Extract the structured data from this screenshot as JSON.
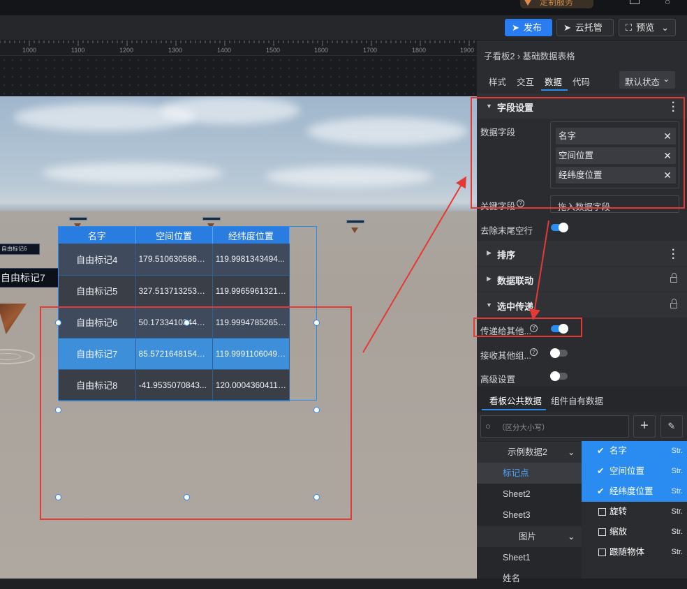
{
  "topbar": {
    "brand_text": "定制服务"
  },
  "toolbar": {
    "publish": "发布",
    "cloud": "云托管",
    "preview": "预览"
  },
  "ruler": {
    "ticks": [
      "1000",
      "1100",
      "1200",
      "1300",
      "1400",
      "1500",
      "1600",
      "1700",
      "1800",
      "1900"
    ]
  },
  "scene": {
    "label_mark6": "自由标记6",
    "label_mark7": "自由标记7"
  },
  "table": {
    "headers": [
      "名字",
      "空间位置",
      "经纬度位置"
    ],
    "rows": [
      [
        "自由标记4",
        "179.51063058621...",
        "119.9981343494..."
      ],
      [
        "自由标记5",
        "327.51371325368...",
        "119.99659613210..."
      ],
      [
        "自由标记6",
        "50.173341034473...",
        "119.99947852657..."
      ],
      [
        "自由标记7",
        "85.572164815412...",
        "119.99911060497..."
      ],
      [
        "自由标记8",
        "-41.9535070843...",
        "120.00043604119..."
      ]
    ]
  },
  "panel": {
    "breadcrumb_parent": "子看板2",
    "breadcrumb_current": "基础数据表格",
    "tabs": [
      "样式",
      "交互",
      "数据",
      "代码"
    ],
    "active_tab": "数据",
    "state_select": "默认状态",
    "field_section": "字段设置",
    "data_fields_label": "数据字段",
    "data_fields": [
      "名字",
      "空间位置",
      "经纬度位置"
    ],
    "key_field_label": "关键字段",
    "key_field_placeholder": "拖入数据字段",
    "trim_label": "去除末尾空行",
    "sort_section": "排序",
    "linkage_section": "数据联动",
    "select_pass_section": "选中传递",
    "pass_to_others": "传递给其他...",
    "receive_others": "接收其他组...",
    "advanced": "高级设置",
    "data_tabs": [
      "看板公共数据",
      "组件自有数据"
    ],
    "search_placeholder": "（区分大小写）",
    "tree": {
      "group1": "示例数据2",
      "items1": [
        "标记点",
        "Sheet2",
        "Sheet3"
      ],
      "group2": "图片",
      "items2": [
        "Sheet1",
        "姓名"
      ]
    },
    "field_list": [
      {
        "name": "名字",
        "type": "Str.",
        "checked": true
      },
      {
        "name": "空间位置",
        "type": "Str.",
        "checked": true
      },
      {
        "name": "经纬度位置",
        "type": "Str.",
        "checked": true
      },
      {
        "name": "旋转",
        "type": "Str.",
        "checked": false
      },
      {
        "name": "缩放",
        "type": "Str.",
        "checked": false
      },
      {
        "name": "跟随物体",
        "type": "Str.",
        "checked": false
      }
    ],
    "accent_color": "#2a8cf0",
    "highlight_color": "#e53935"
  }
}
